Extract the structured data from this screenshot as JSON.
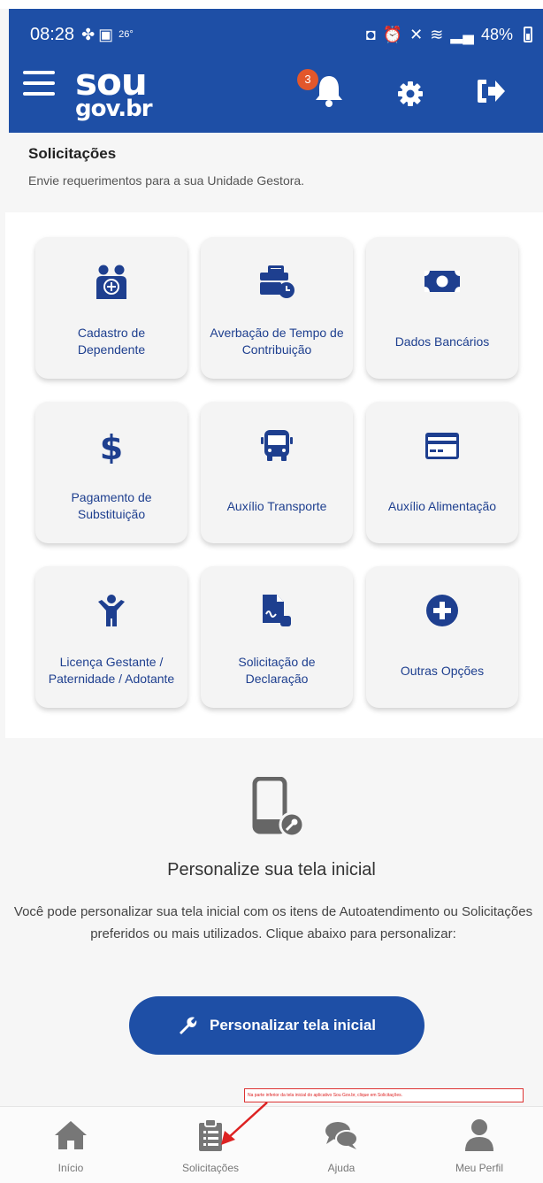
{
  "status_bar": {
    "time": "08:28",
    "temperature": "26°",
    "battery": "48%",
    "left_icons": [
      "pinwheel-icon",
      "image-icon"
    ],
    "right_icons": [
      "lock-icon",
      "alarm-icon",
      "mute-icon",
      "wifi-icon",
      "signal-icon",
      "battery-icon"
    ]
  },
  "header": {
    "logo_line1": "sou",
    "logo_line2": "gov.br",
    "notification_count": "3",
    "background_color": "#1e4fa6",
    "badge_color": "#e2572b"
  },
  "page": {
    "title": "Solicitações",
    "subtitle": "Envie requerimentos para a sua Unidade Gestora."
  },
  "tiles": [
    {
      "id": "cadastro-dependente",
      "icon": "family-add-icon",
      "label": "Cadastro de Dependente"
    },
    {
      "id": "averbacao",
      "icon": "briefcase-clock-icon",
      "label": "Averbação de Tempo de Contribuição"
    },
    {
      "id": "dados-bancarios",
      "icon": "money-bill-icon",
      "label": "Dados Bancários"
    },
    {
      "id": "pagamento-substituicao",
      "icon": "dollar-icon",
      "label": "Pagamento de Substituição"
    },
    {
      "id": "auxilio-transporte",
      "icon": "bus-icon",
      "label": "Auxílio Transporte"
    },
    {
      "id": "auxilio-alimentacao",
      "icon": "card-icon",
      "label": "Auxílio Alimentação"
    },
    {
      "id": "licenca",
      "icon": "child-icon",
      "label": "Licença Gestante / Paternidade / Adotante"
    },
    {
      "id": "declaracao",
      "icon": "document-signature-icon",
      "label": "Solicitação de Declaração"
    },
    {
      "id": "outras-opcoes",
      "icon": "plus-circle-icon",
      "label": "Outras Opções"
    }
  ],
  "personalize": {
    "title": "Personalize sua tela inicial",
    "description": "Você pode personalizar sua tela inicial com os itens de Autoatendimento ou Solicitações preferidos ou mais utilizados. Clique abaixo para personalizar:",
    "button_label": "Personalizar tela inicial"
  },
  "annotation": {
    "text": "Na parte inferior da tela inicial do aplicativo Sou Gov.br, clique em Solicitações.",
    "color": "#dd2222"
  },
  "bottom_nav": [
    {
      "icon": "home-icon",
      "label": "Início"
    },
    {
      "icon": "clipboard-icon",
      "label": "Solicitações"
    },
    {
      "icon": "chat-icon",
      "label": "Ajuda"
    },
    {
      "icon": "user-icon",
      "label": "Meu Perfil"
    }
  ]
}
